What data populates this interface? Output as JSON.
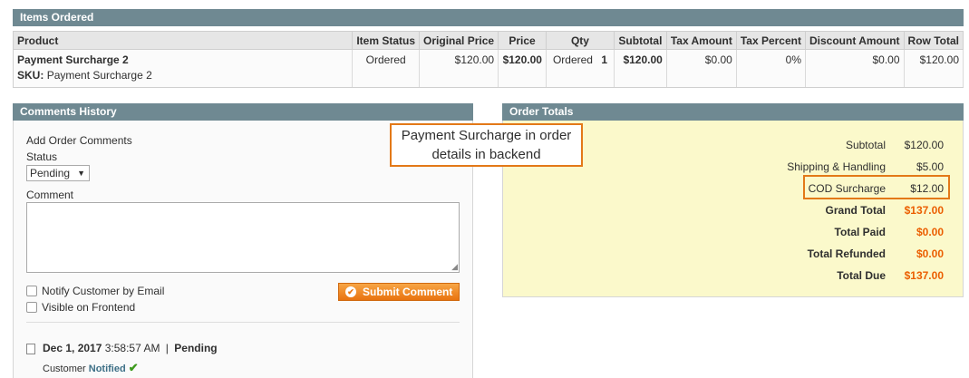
{
  "items_ordered": {
    "title": "Items Ordered",
    "columns": [
      "Product",
      "Item Status",
      "Original Price",
      "Price",
      "Qty",
      "Subtotal",
      "Tax Amount",
      "Tax Percent",
      "Discount Amount",
      "Row Total"
    ],
    "row": {
      "product_name": "Payment Surcharge 2",
      "sku_label": "SKU:",
      "sku_value": "Payment Surcharge 2",
      "item_status": "Ordered",
      "original_price": "$120.00",
      "price": "$120.00",
      "qty_label": "Ordered",
      "qty_value": "1",
      "subtotal": "$120.00",
      "tax_amount": "$0.00",
      "tax_percent": "0%",
      "discount_amount": "$0.00",
      "row_total": "$120.00"
    }
  },
  "comments_history": {
    "title": "Comments History",
    "add_label": "Add Order Comments",
    "status_label": "Status",
    "status_selected": "Pending",
    "comment_label": "Comment",
    "notify_label": "Notify Customer by Email",
    "visible_label": "Visible on Frontend",
    "submit_label": "Submit Comment",
    "entry": {
      "date": "Dec 1, 2017",
      "time": "3:58:57 AM",
      "separator": "|",
      "status": "Pending",
      "customer_label": "Customer",
      "notified_label": "Notified",
      "check_glyph": "✔"
    }
  },
  "order_totals": {
    "title": "Order Totals",
    "rows": [
      {
        "label": "Subtotal",
        "value": "$120.00"
      },
      {
        "label": "Shipping & Handling",
        "value": "$5.00"
      },
      {
        "label": "COD Surcharge",
        "value": "$12.00"
      },
      {
        "label": "Grand Total",
        "value": "$137.00"
      },
      {
        "label": "Total Paid",
        "value": "$0.00"
      },
      {
        "label": "Total Refunded",
        "value": "$0.00"
      },
      {
        "label": "Total Due",
        "value": "$137.00"
      }
    ]
  },
  "callout": {
    "line1": "Payment Surcharge in order",
    "line2": "details in backend"
  },
  "colors": {
    "panel_header": "#6f8992",
    "totals_background": "#fbf9cb",
    "accent_orange": "#e37918",
    "total_red": "#eb5e00",
    "notified_green": "#3d9a1d"
  },
  "icons": {
    "status_dropdown": "chevron-down-icon",
    "submit": "check-circle-icon",
    "history_entry": "document-icon",
    "notified": "checkmark-icon"
  }
}
